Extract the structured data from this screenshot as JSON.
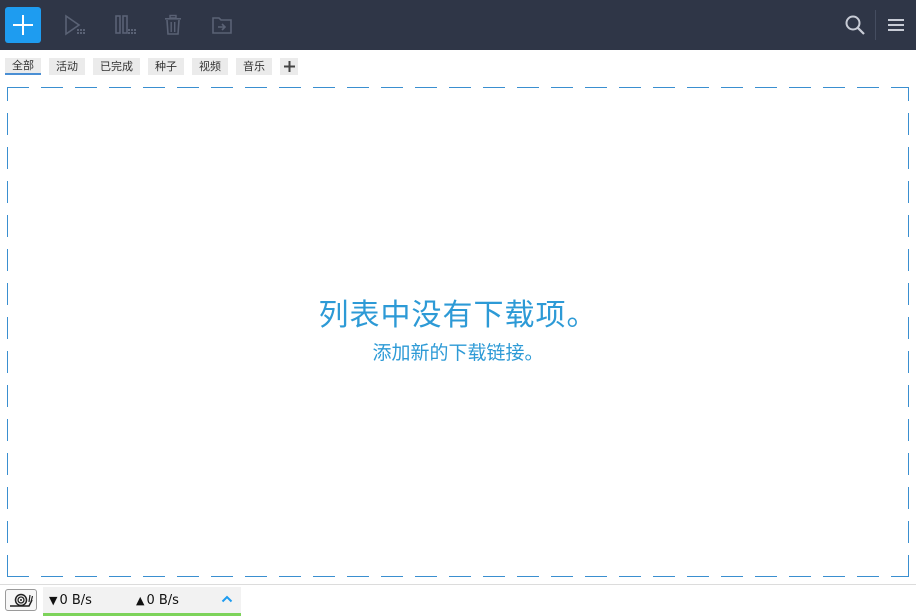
{
  "toolbar": {
    "icons": [
      "add-icon",
      "play-icon",
      "pause-icon",
      "trash-icon",
      "move-to-folder-icon",
      "search-icon",
      "menu-icon"
    ],
    "accent_color": "#1e9cf0",
    "background_color": "#2f3647"
  },
  "tabs": {
    "items": [
      {
        "label": "全部",
        "active": true
      },
      {
        "label": "活动",
        "active": false
      },
      {
        "label": "已完成",
        "active": false
      },
      {
        "label": "种子",
        "active": false
      },
      {
        "label": "视频",
        "active": false
      },
      {
        "label": "音乐",
        "active": false
      }
    ],
    "add_icon": "plus-icon"
  },
  "empty_state": {
    "title": "列表中没有下载项。",
    "subtitle": "添加新的下载链接。",
    "text_color": "#2d9ad6"
  },
  "statusbar": {
    "snail_icon": "snail-icon",
    "download_speed": "0 B/s",
    "upload_speed": "0 B/s",
    "download_arrow": "▼",
    "upload_arrow": "▲",
    "expand_icon": "chevron-up-icon",
    "indicator_color": "#7dd35a"
  }
}
